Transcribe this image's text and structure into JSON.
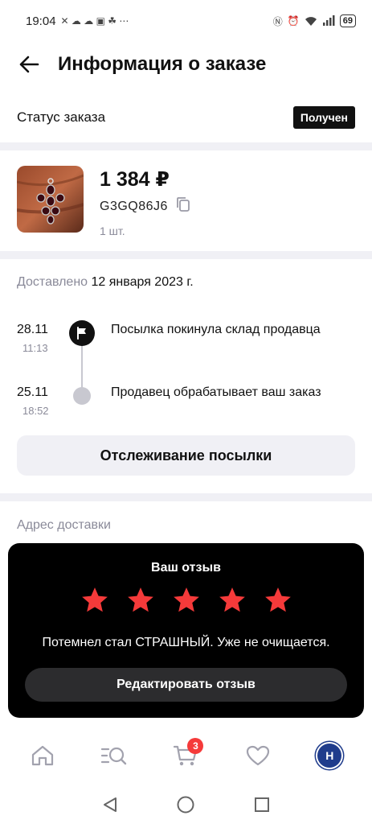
{
  "statusbar": {
    "time": "19:04",
    "battery": "69"
  },
  "header": {
    "title": "Информация о заказе"
  },
  "order_status": {
    "label": "Статус заказа",
    "value": "Получен"
  },
  "product": {
    "price": "1 384 ₽",
    "code": "G3GQ86J6",
    "quantity": "1 шт."
  },
  "delivery": {
    "label": "Доставлено",
    "date": "12 января 2023 г."
  },
  "tracking": {
    "events": [
      {
        "date": "28.11",
        "time": "11:13",
        "text": "Посылка покинула склад продавца"
      },
      {
        "date": "25.11",
        "time": "18:52",
        "text": "Продавец обрабатывает ваш заказ"
      }
    ],
    "button_label": "Отслеживание посылки"
  },
  "address": {
    "label": "Адрес доставки"
  },
  "review": {
    "title": "Ваш отзыв",
    "rating": 5,
    "rating_max": 5,
    "text": "Потемнел стал СТРАШНЫЙ. Уже не очищается.",
    "edit_label": "Редактировать отзыв"
  },
  "bottom_nav": {
    "items": [
      {
        "icon": "home-icon"
      },
      {
        "icon": "catalog-search-icon"
      },
      {
        "icon": "cart-icon",
        "badge": "3"
      },
      {
        "icon": "heart-icon"
      },
      {
        "icon": "profile-avatar",
        "initial": "Н"
      }
    ]
  },
  "colors": {
    "accent_red": "#f53a3a",
    "badge_dark": "#111111",
    "muted": "#8a8a99",
    "avatar_blue": "#1f3c8c"
  }
}
